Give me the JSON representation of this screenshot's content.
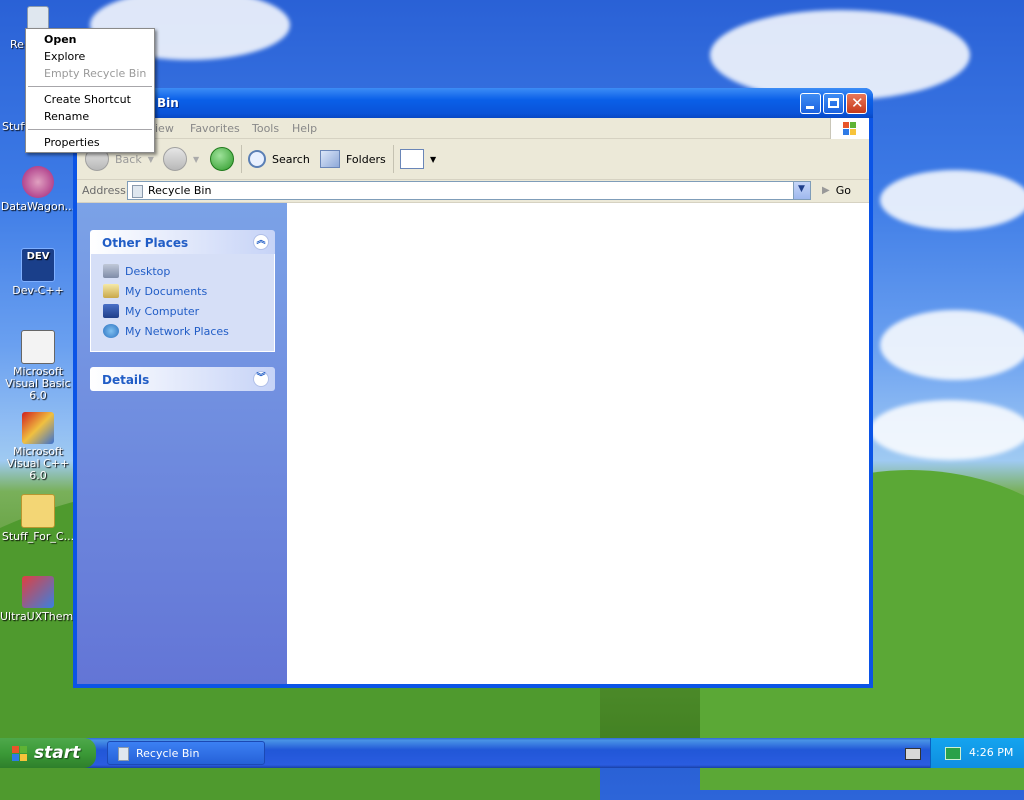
{
  "desktop": {
    "icons": [
      {
        "label": "Re",
        "icon": "recycle-bin-icon"
      },
      {
        "label": "Stuff",
        "icon": "folder-icon"
      },
      {
        "label": "DataWagon...",
        "icon": "datawagon-icon"
      },
      {
        "label": "Dev-C++",
        "icon": "devcpp-icon"
      },
      {
        "label": "Microsoft Visual Basic 6.0",
        "icon": "vb6-icon"
      },
      {
        "label": "Microsoft Visual C++ 6.0",
        "icon": "vc6-icon"
      },
      {
        "label": "Stuff_For_C...",
        "icon": "zipped-folder-icon"
      },
      {
        "label": "UltraUXThem...",
        "icon": "ultrauxtheme-icon"
      }
    ]
  },
  "context_menu": {
    "items": [
      {
        "label": "Open",
        "style": "bold"
      },
      {
        "label": "Explore",
        "style": "normal"
      },
      {
        "label": "Empty Recycle Bin",
        "style": "disabled"
      },
      {
        "label": "Create Shortcut",
        "style": "normal"
      },
      {
        "label": "Rename",
        "style": "normal"
      },
      {
        "label": "Properties",
        "style": "normal"
      }
    ]
  },
  "window": {
    "title": "Bin",
    "menu": [
      "iew",
      "Favorites",
      "Tools",
      "Help"
    ],
    "toolbar": {
      "back": "Back",
      "search": "Search",
      "folders": "Folders"
    },
    "address": {
      "label": "Address",
      "value": "Recycle Bin",
      "go": "Go"
    },
    "task_pane": {
      "other_places": {
        "title": "Other Places",
        "items": [
          "Desktop",
          "My Documents",
          "My Computer",
          "My Network Places"
        ]
      },
      "details": {
        "title": "Details"
      }
    }
  },
  "taskbar": {
    "start": "start",
    "task": "Recycle Bin",
    "clock": "4:26 PM"
  },
  "colors": {
    "taskbar_blue": "#2157d7",
    "start_green": "#3b9a37",
    "link_blue": "#215dc6"
  }
}
